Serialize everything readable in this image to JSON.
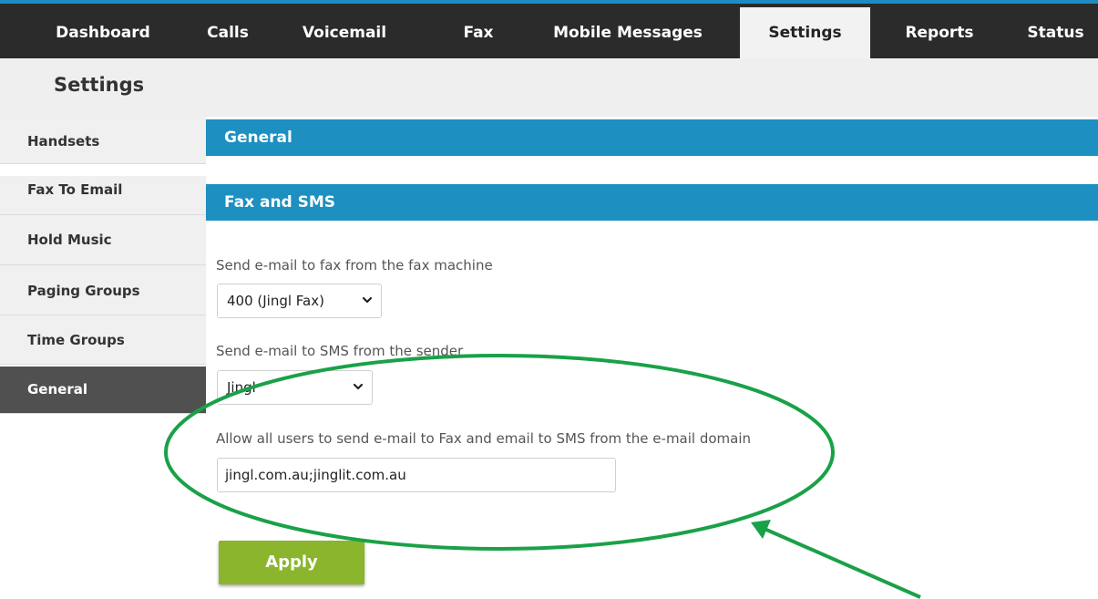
{
  "topnav": {
    "tabs": [
      {
        "label": "Dashboard"
      },
      {
        "label": "Calls"
      },
      {
        "label": "Voicemail"
      },
      {
        "label": "Fax"
      },
      {
        "label": "Mobile Messages"
      },
      {
        "label": "Settings",
        "active": true
      },
      {
        "label": "Reports"
      },
      {
        "label": "Status"
      }
    ]
  },
  "page": {
    "title": "Settings"
  },
  "sidebar": {
    "items": [
      {
        "label": "Handsets"
      },
      {
        "label": "Fax To Email"
      },
      {
        "label": "Hold Music"
      },
      {
        "label": "Paging Groups"
      },
      {
        "label": "Time Groups"
      },
      {
        "label": "General",
        "active": true
      }
    ]
  },
  "main": {
    "general_header": "General",
    "fax_sms_header": "Fax and SMS",
    "fax_machine": {
      "label": "Send e-mail to fax from the fax machine",
      "value": "400 (Jingl Fax)"
    },
    "sms_sender": {
      "label": "Send e-mail to SMS from the sender",
      "value": "Jingl"
    },
    "domain": {
      "label": "Allow all users to send e-mail to Fax and email to SMS from the e-mail domain",
      "value": "jingl.com.au;jinglit.com.au"
    },
    "apply_label": "Apply"
  },
  "colors": {
    "nav_bg": "#2b2b2b",
    "accent_blue": "#1d8fc0",
    "apply_green": "#8ab52c",
    "annotation_green": "#1aa148"
  },
  "icons": {
    "select_chevron": "chevron-down-icon"
  }
}
